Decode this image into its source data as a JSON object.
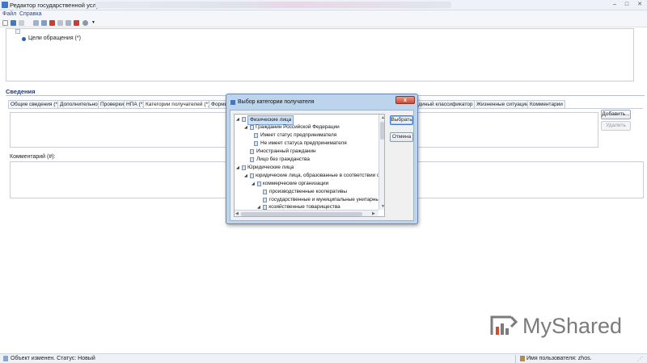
{
  "window": {
    "title": "Редактор государственной услуги",
    "minimize": "–",
    "maximize": "□",
    "close": "✕"
  },
  "menu": {
    "file": "Файл",
    "help": "Справка"
  },
  "toolbar": {
    "icons": [
      "new-icon",
      "save-icon",
      "open-icon",
      "print-icon",
      "copy-icon",
      "delete-icon",
      "settings-icon",
      "refresh-icon",
      "help-icon"
    ],
    "colors": {
      "accent": "#3f78c6",
      "danger": "#d23a2a",
      "neutral": "#8c97a8"
    }
  },
  "upper_tree": {
    "goal_item": "Цели обращения (*)"
  },
  "section": {
    "title": "Сведения"
  },
  "tabs": [
    "Общие сведения (*)",
    "Дополнительно",
    "Проверки",
    "НПА (*)",
    "Категории получателей (*)",
    "Формы",
    "Единый классификатор",
    "Жизненные ситуации",
    "Комментарии"
  ],
  "buttons": {
    "add": "Добавить...",
    "delete": "Удалить"
  },
  "comment": {
    "label": "Комментарий (#):"
  },
  "dialog": {
    "title": "Выбор категории получателя",
    "close": "x",
    "ok": "Выбрать",
    "cancel": "Отмена",
    "tree": [
      {
        "label": "Физические лица",
        "level": 0,
        "expanded": true,
        "selected": true
      },
      {
        "label": "Гражданин Российской Федерации",
        "level": 1,
        "expanded": true
      },
      {
        "label": "Имеет статус предпринимателя",
        "level": 2
      },
      {
        "label": "Не имеет статуса предпринимателя",
        "level": 2
      },
      {
        "label": "Иностранный гражданин",
        "level": 1
      },
      {
        "label": "Лицо без гражданства",
        "level": 1
      },
      {
        "label": "Юридические лица",
        "level": 0,
        "expanded": true
      },
      {
        "label": "юридические лица, образованные в соответствии с",
        "level": 1,
        "expanded": true
      },
      {
        "label": "коммерческие организации",
        "level": 2,
        "expanded": true
      },
      {
        "label": "производственные кооперативы",
        "level": 3
      },
      {
        "label": "государственные и муниципальные унитарны",
        "level": 3
      },
      {
        "label": "хозяйственные товарищества",
        "level": 3,
        "expanded": true
      }
    ]
  },
  "status": {
    "left": "Объект изменен. Статус: Новый",
    "right": "Имя пользователя: zhos."
  },
  "watermark": {
    "text": "MyShared",
    "color": "#7b7b7b"
  }
}
